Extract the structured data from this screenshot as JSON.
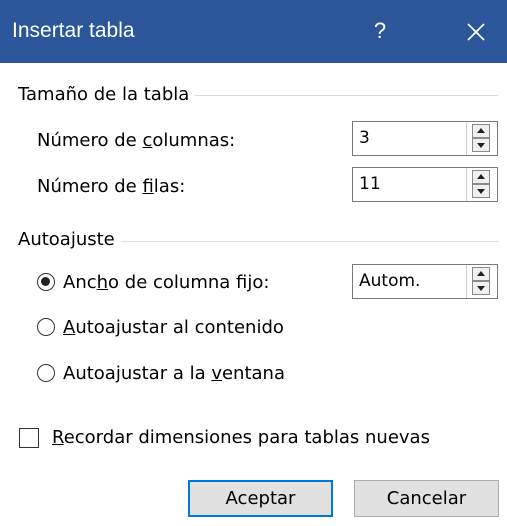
{
  "dialog": {
    "title": "Insertar tabla",
    "help": "?"
  },
  "size_group": {
    "title": "Tamaño de la tabla",
    "columns_label": [
      "Número de ",
      "c",
      "olumnas:"
    ],
    "columns_value": "3",
    "rows_label": [
      "Número de ",
      "f",
      "ilas:"
    ],
    "rows_value": "11"
  },
  "autofit_group": {
    "title": "Autoajuste",
    "fixed_width_label": [
      "Anc",
      "h",
      "o de columna fijo:"
    ],
    "fixed_width_value": "Autom.",
    "fit_contents_label": [
      "",
      "A",
      "utoajustar al contenido"
    ],
    "fit_window_label": [
      "Autoajustar a la ",
      "v",
      "entana"
    ],
    "selected": "fixed_width"
  },
  "remember_label": [
    "",
    "R",
    "ecordar dimensiones para tablas nuevas"
  ],
  "remember_checked": false,
  "buttons": {
    "ok": "Aceptar",
    "cancel": "Cancelar"
  },
  "colors": {
    "titlebar": "#2b579a",
    "default_button_border": "#0078d7"
  }
}
